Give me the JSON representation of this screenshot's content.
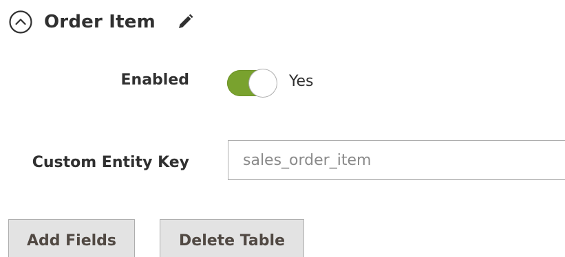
{
  "section": {
    "title": "Order Item",
    "collapse_icon": "collapse-circle-icon",
    "edit_icon": "pencil-icon"
  },
  "fields": {
    "enabled": {
      "label": "Enabled",
      "value": true,
      "state_text": "Yes",
      "color_on": "#79a22e"
    },
    "custom_entity_key": {
      "label": "Custom Entity Key",
      "value": "",
      "placeholder": "sales_order_item"
    }
  },
  "actions": {
    "add_fields": "Add Fields",
    "delete_table": "Delete Table"
  }
}
